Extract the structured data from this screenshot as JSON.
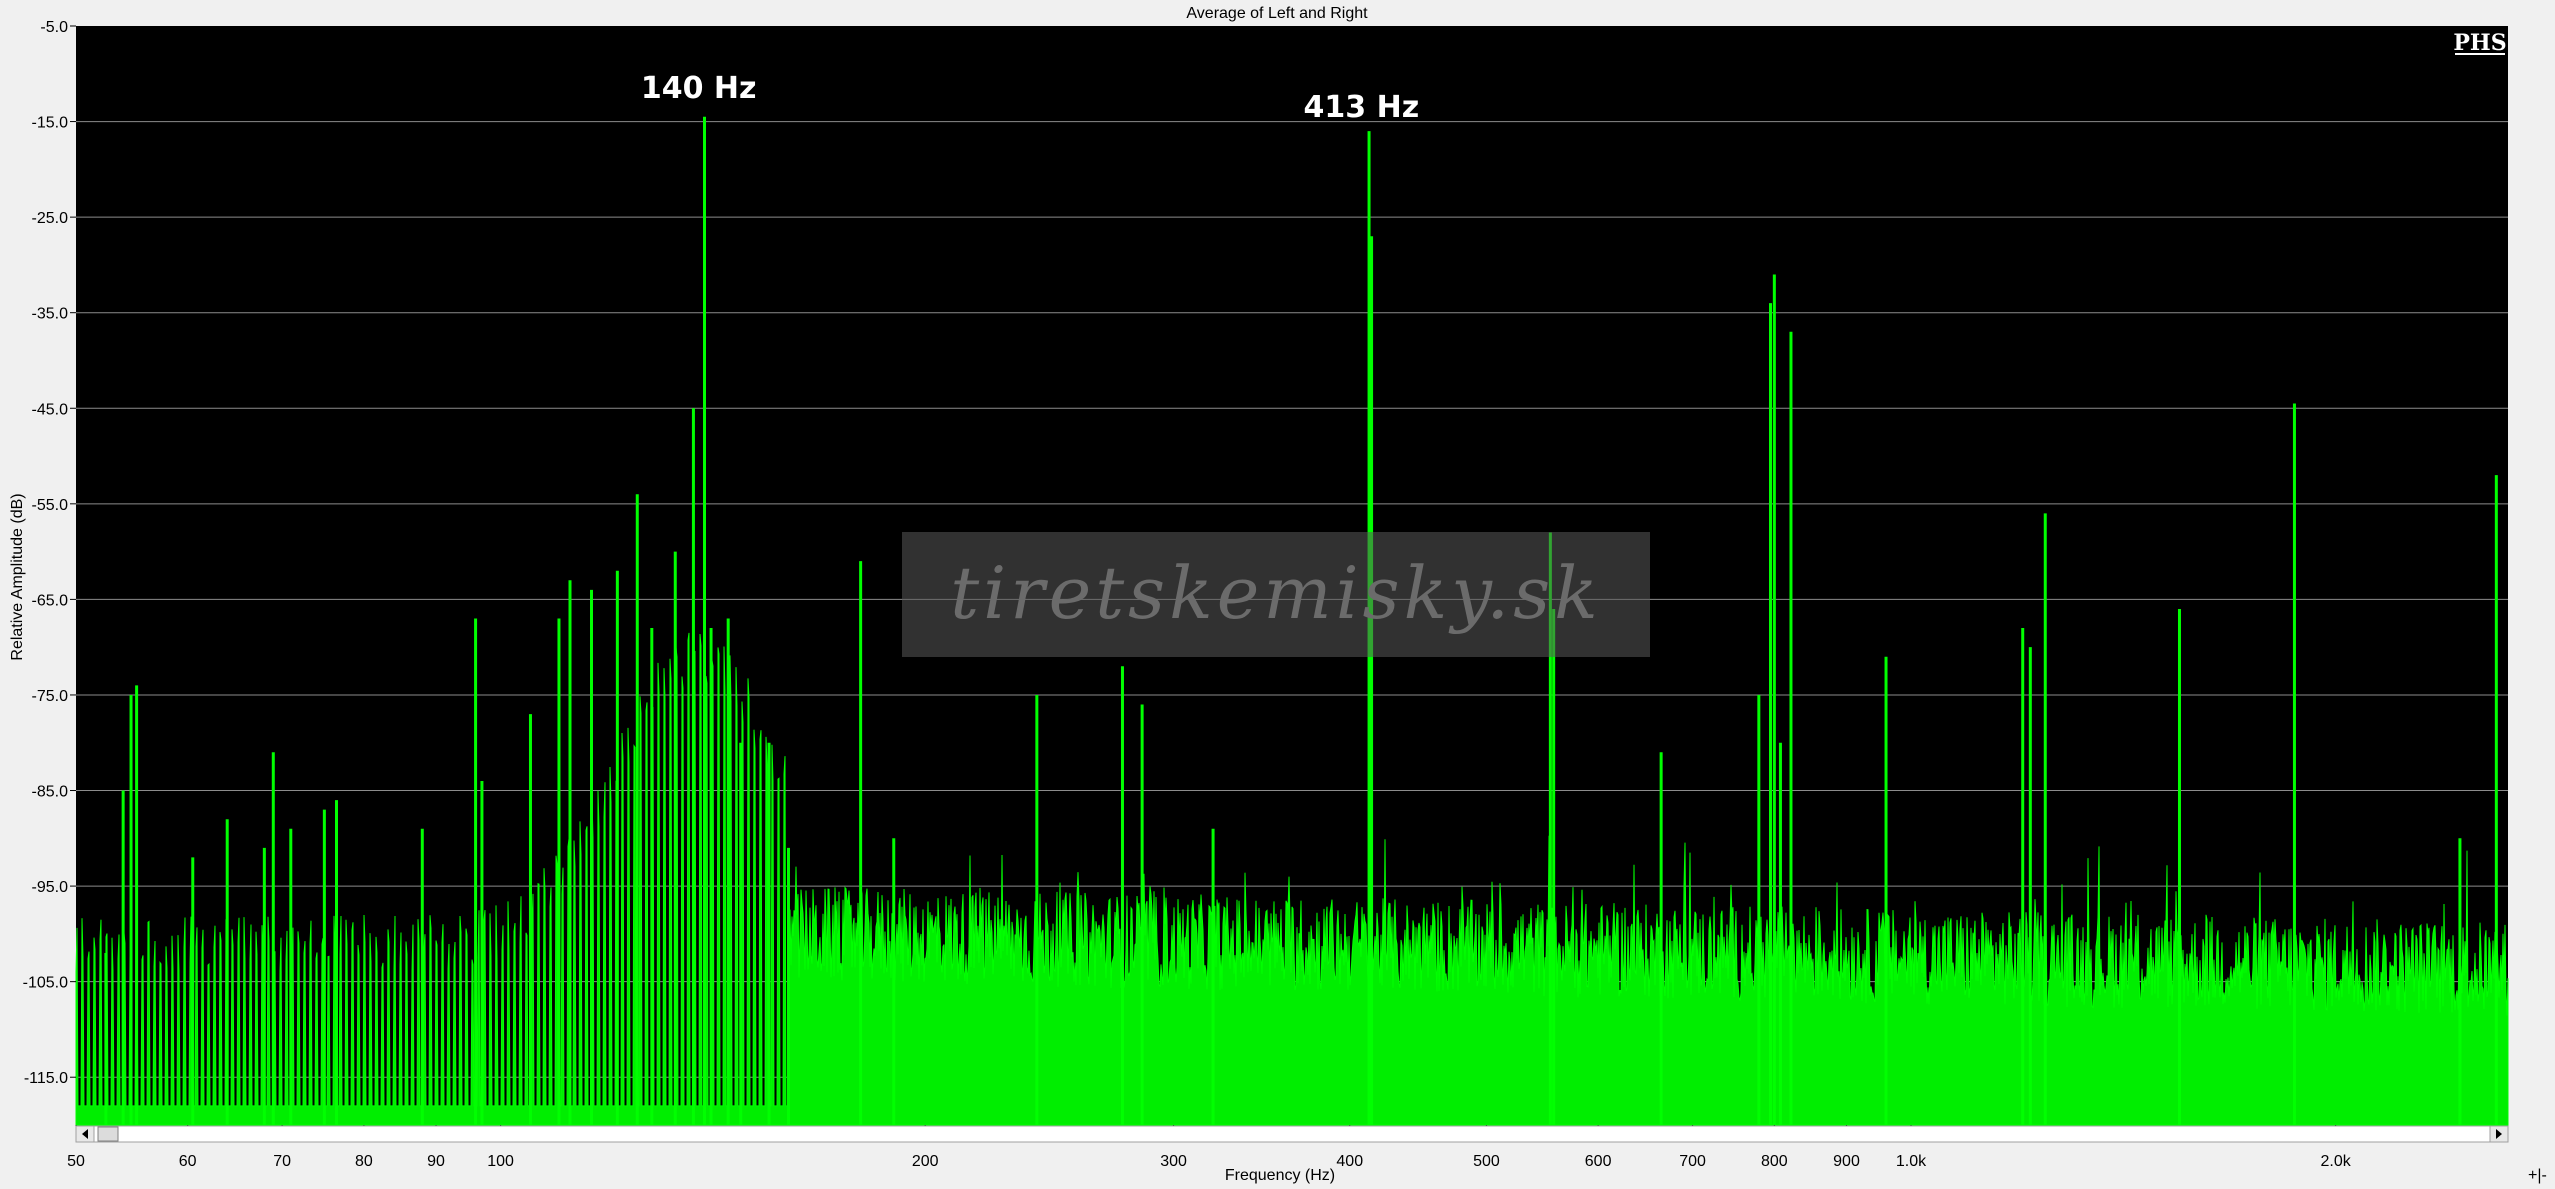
{
  "chart_data": {
    "type": "area",
    "title": "Average of Left and Right",
    "xlabel": "Frequency (Hz)",
    "ylabel": "Relative Amplitude (dB)",
    "x_scale": "log",
    "xlim": [
      50,
      2650
    ],
    "ylim": [
      -120,
      -5
    ],
    "grid": true,
    "x_ticks": [
      {
        "value": 50,
        "label": "50"
      },
      {
        "value": 60,
        "label": "60"
      },
      {
        "value": 70,
        "label": "70"
      },
      {
        "value": 80,
        "label": "80"
      },
      {
        "value": 90,
        "label": "90"
      },
      {
        "value": 100,
        "label": "100"
      },
      {
        "value": 200,
        "label": "200"
      },
      {
        "value": 300,
        "label": "300"
      },
      {
        "value": 400,
        "label": "400"
      },
      {
        "value": 500,
        "label": "500"
      },
      {
        "value": 600,
        "label": "600"
      },
      {
        "value": 700,
        "label": "700"
      },
      {
        "value": 800,
        "label": "800"
      },
      {
        "value": 900,
        "label": "900"
      },
      {
        "value": 1000,
        "label": "1.0k"
      },
      {
        "value": 2000,
        "label": "2.0k"
      }
    ],
    "y_ticks": [
      {
        "value": -5,
        "label": "-5.0"
      },
      {
        "value": -15,
        "label": "-15.0"
      },
      {
        "value": -25,
        "label": "-25.0"
      },
      {
        "value": -35,
        "label": "-35.0"
      },
      {
        "value": -45,
        "label": "-45.0"
      },
      {
        "value": -55,
        "label": "-55.0"
      },
      {
        "value": -65,
        "label": "-65.0"
      },
      {
        "value": -75,
        "label": "-75.0"
      },
      {
        "value": -85,
        "label": "-85.0"
      },
      {
        "value": -95,
        "label": "-95.0"
      },
      {
        "value": -105,
        "label": "-105.0"
      },
      {
        "value": -115,
        "label": "-115.0"
      }
    ],
    "noise_floor_db": -100,
    "peaks": [
      {
        "x": 52.5,
        "y": -102
      },
      {
        "x": 54,
        "y": -85
      },
      {
        "x": 54.7,
        "y": -75
      },
      {
        "x": 55.2,
        "y": -74
      },
      {
        "x": 60.5,
        "y": -92
      },
      {
        "x": 64,
        "y": -88
      },
      {
        "x": 68,
        "y": -91
      },
      {
        "x": 69,
        "y": -81
      },
      {
        "x": 71,
        "y": -89
      },
      {
        "x": 75,
        "y": -87
      },
      {
        "x": 76.5,
        "y": -86
      },
      {
        "x": 88,
        "y": -89
      },
      {
        "x": 96,
        "y": -67
      },
      {
        "x": 97,
        "y": -84
      },
      {
        "x": 105,
        "y": -77
      },
      {
        "x": 110,
        "y": -67
      },
      {
        "x": 112,
        "y": -63
      },
      {
        "x": 116,
        "y": -64
      },
      {
        "x": 121,
        "y": -62
      },
      {
        "x": 125,
        "y": -54
      },
      {
        "x": 128,
        "y": -68
      },
      {
        "x": 133,
        "y": -60
      },
      {
        "x": 137,
        "y": -45
      },
      {
        "x": 139.5,
        "y": -14.5
      },
      {
        "x": 141,
        "y": -68
      },
      {
        "x": 145,
        "y": -67
      },
      {
        "x": 148,
        "y": -80
      },
      {
        "x": 155,
        "y": -80
      },
      {
        "x": 160,
        "y": -91
      },
      {
        "x": 180,
        "y": -61
      },
      {
        "x": 190,
        "y": -90
      },
      {
        "x": 240,
        "y": -75
      },
      {
        "x": 276,
        "y": -72
      },
      {
        "x": 285,
        "y": -76
      },
      {
        "x": 320,
        "y": -89
      },
      {
        "x": 412.8,
        "y": -16
      },
      {
        "x": 414.5,
        "y": -27
      },
      {
        "x": 555,
        "y": -58
      },
      {
        "x": 558,
        "y": -66
      },
      {
        "x": 665,
        "y": -81
      },
      {
        "x": 780,
        "y": -75
      },
      {
        "x": 795,
        "y": -34
      },
      {
        "x": 800,
        "y": -31
      },
      {
        "x": 808,
        "y": -80
      },
      {
        "x": 822,
        "y": -37
      },
      {
        "x": 960,
        "y": -71
      },
      {
        "x": 1200,
        "y": -68
      },
      {
        "x": 1215,
        "y": -70
      },
      {
        "x": 1245,
        "y": -56
      },
      {
        "x": 1550,
        "y": -66
      },
      {
        "x": 1870,
        "y": -44.5
      },
      {
        "x": 2450,
        "y": -90
      },
      {
        "x": 2600,
        "y": -52
      }
    ],
    "annotations": [
      {
        "text": "140 Hz",
        "x": 140,
        "y": -11.5
      },
      {
        "text": "413 Hz",
        "x": 413,
        "y": -13.5
      }
    ],
    "watermark_text": "tiretskemisky.sk",
    "logo": "PHS",
    "colors": {
      "plot_bg": "#000000",
      "spectrum_fill": "#00ee00",
      "spectrum_stroke": "#00ff00",
      "grid": "#8c8c8c",
      "annotation": "#ffffff",
      "frame_bg": "#f0f0f0"
    }
  }
}
